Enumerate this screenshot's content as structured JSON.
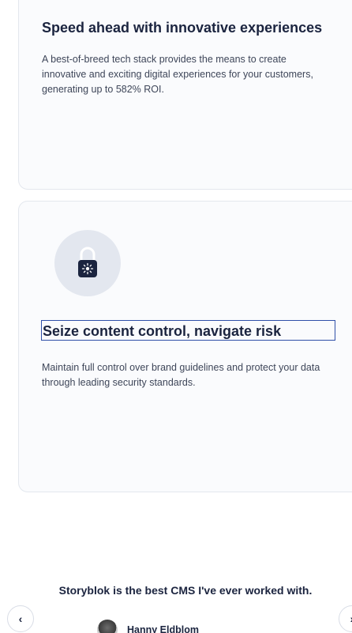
{
  "cards": [
    {
      "title": "Speed ahead with innovative experiences",
      "text": "A best-of-breed tech stack provides the means to create innovative and exciting digital experiences for your customers, generating up to 582% ROI."
    },
    {
      "icon": "lock-icon",
      "title": "Seize content control, navigate risk",
      "text": "Maintain full control over brand guidelines and protect your data through leading security standards."
    }
  ],
  "testimonial": {
    "quote": "Storyblok is the best CMS I've ever worked with.",
    "author": "Hanny Eldblom",
    "prev_label": "‹",
    "next_label": "›"
  }
}
